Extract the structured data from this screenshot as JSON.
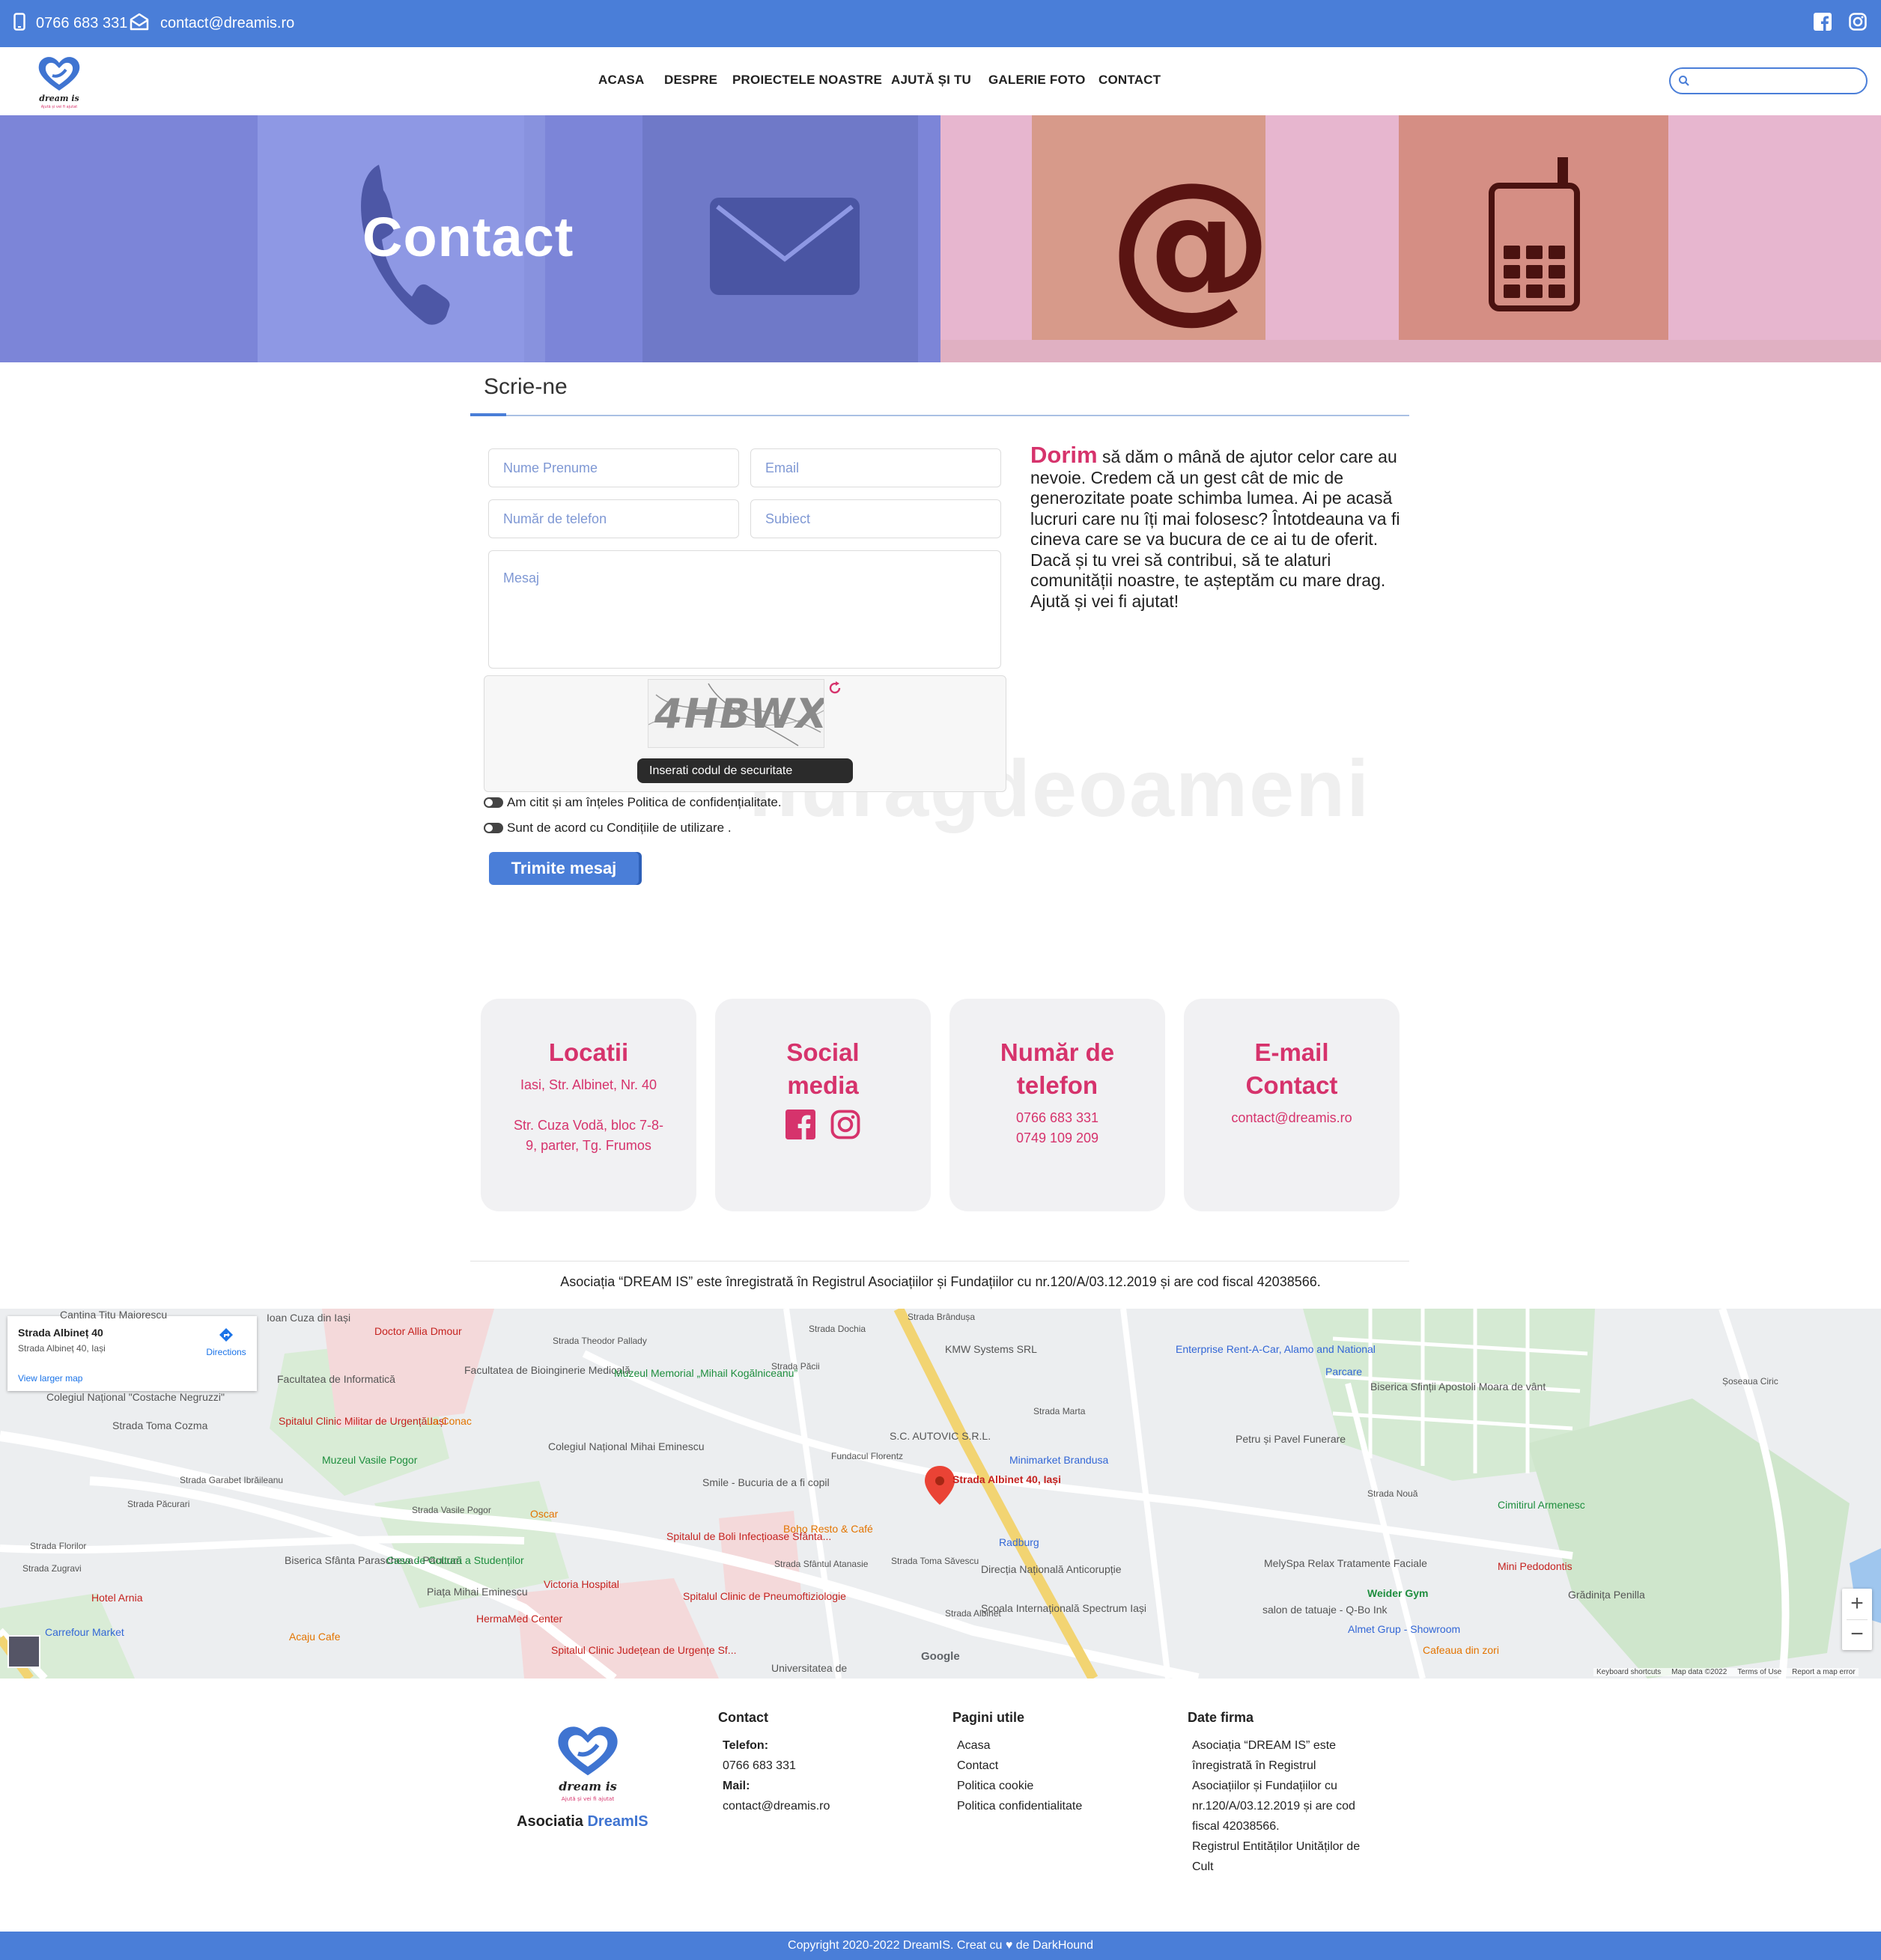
{
  "topbar": {
    "phone": "0766 683 331",
    "email": "contact@dreamis.ro",
    "social": [
      "facebook-icon",
      "instagram-icon"
    ]
  },
  "header": {
    "logo_text": "dream is",
    "logo_tagline": "Ajută și vei fi ajutat",
    "nav": [
      "ACASA",
      "DESPRE",
      "PROIECTELE NOASTRE",
      "AJUTĂ ȘI TU",
      "GALERIE FOTO",
      "CONTACT"
    ],
    "search_placeholder": ""
  },
  "hero": {
    "title": "Contact"
  },
  "form": {
    "heading": "Scrie-ne",
    "name_placeholder": "Nume Prenume",
    "email_placeholder": "Email",
    "phone_placeholder": "Număr de telefon",
    "subject_placeholder": "Subiect",
    "message_placeholder": "Mesaj",
    "captcha_code": "4HBWX",
    "captcha_tip": "Inserati codul de securitate",
    "privacy_label": "Am citit și am înțeles Politica de confidențialitate.",
    "terms_label": "Sunt de acord cu Condițiile de utilizare .",
    "submit_label": "Trimite mesaj"
  },
  "description": {
    "highlight": "Dorim",
    "text": " să dăm o mână de ajutor celor care au nevoie. Credem că un gest cât de mic de generozitate poate schimba lumea. Ai pe acasă lucruri care nu îți mai folosesc? Întotdeauna va fi cineva care se va bucura de ce ai tu de oferit. Dacă și tu vrei să contribui, să te alaturi comunității noastre, te așteptăm cu mare drag. Ajută și vei fi ajutat!",
    "watermark": "nuragdeoameni"
  },
  "cards": {
    "locations": {
      "title": "Locatii",
      "line1": "Iasi, Str. Albinet, Nr. 40",
      "line2": "Str. Cuza Vodă, bloc 7-8-9, parter, Tg. Frumos"
    },
    "social": {
      "title": "Social media"
    },
    "phone": {
      "title": "Număr de telefon",
      "line1": "0766 683 331",
      "line2": "0749 109 209"
    },
    "email": {
      "title": "E-mail Contact",
      "line1": "contact@dreamis.ro"
    }
  },
  "registration": "Asociația “DREAM IS” este înregistrată în Registrul Asociațiilor și Fundațiilor cu nr.120/A/03.12.2019 și are cod fiscal 42038566.",
  "map": {
    "place_title": "Strada Albineț 40",
    "place_address": "Strada Albineț 40, Iași",
    "directions": "Directions",
    "view_larger": "View larger map",
    "marker_label": "Strada Albinet 40, Iași",
    "labels": [
      "Cantina Titu Maiorescu",
      "Ioan Cuza din Iași",
      "Doctor Allia Dmour",
      "Facultatea de Informatică",
      "Facultatea de Bioinginerie Medicală",
      "Muzeul Memorial „Mihail Kogălniceanu”",
      "KMW Systems SRL",
      "Enterprise Rent-A-Car, Alamo and National",
      "Parcare",
      "Biserica Sfinții Apostoli Moara de vânt",
      "Colegiul Național \"Costache Negruzzi\"",
      "Strada Toma Cozma",
      "Spitalul Clinic Militar de Urgență Iași",
      "La Conac",
      "Colegiul Național Mihai Eminescu",
      "S.C. AUTOVIC S.R.L.",
      "Minimarket Brandusa",
      "Petru și Pavel Funerare",
      "Muzeul Vasile Pogor",
      "Smile - Bucuria de a fi copil",
      "Strada Albinet 40, Iași",
      "Cimitirul Armenesc",
      "Oscar",
      "Boho Resto & Café",
      "Radburg",
      "Spitalul de Boli Infecțioase Sfânta...",
      "Biserica Sfânta Parascheva - Păcurari",
      "Casa de Cultură a Studenților",
      "Direcția Națională Anticorupție",
      "MelySpa Relax Tratamente Faciale",
      "Mini Pedodontis",
      "Hotel Arnia",
      "Victoria Hospital",
      "Piața Mihai Eminescu",
      "Spitalul Clinic de Pneumoftiziologie",
      "Weider Gym",
      "Grădinița Penilla",
      "Carrefour Market",
      "Acaju Cafe",
      "HermaMed Center",
      "Școala Internațională Spectrum Iași",
      "salon de tatuaje - Q-Bo Ink",
      "Almet Grup - Showroom",
      "Cafeaua din zori",
      "Spitalul Clinic Județean de Urgențe Sf...",
      "Universitatea de",
      "Strada Garabet Ibrăileanu",
      "Strada Păcurari",
      "Strada Vasile Pogor",
      "Strada Zugravi",
      "Strada Florilor",
      "Strada Theodor Pallady",
      "Strada Brândușa",
      "Strada Păcii",
      "Strada Dochia",
      "Fundacul Florentz",
      "Strada Marta",
      "Strada Nouă",
      "Strada Sfântul Atanasie",
      "Strada Toma Săvescu",
      "Strada Albinet",
      "Șoseaua Ciric"
    ],
    "attribution": [
      "Keyboard shortcuts",
      "Map data ©2022",
      "Terms of Use",
      "Report a map error"
    ],
    "google": "Google"
  },
  "footer": {
    "org_prefix": "Asociatia ",
    "org_name": "DreamIS",
    "contact_title": "Contact",
    "phone_label": "Telefon:",
    "phone_value": "0766 683 331",
    "mail_label": "Mail:",
    "mail_value": "contact@dreamis.ro",
    "pages_title": "Pagini utile",
    "pages": [
      "Acasa",
      "Contact",
      "Politica cookie",
      "Politica confidentialitate"
    ],
    "company_title": "Date firma",
    "company_lines": [
      "Asociația “DREAM IS” este",
      "înregistrată în Registrul",
      "Asociațiilor și Fundațiilor cu",
      "nr.120/A/03.12.2019 și are cod",
      "fiscal 42038566.",
      "Registrul Entităților Unităților de",
      "Cult"
    ],
    "copyright": "Copyright 2020-2022 DreamIS. Creat cu ♥ de DarkHound"
  },
  "colors": {
    "primary": "#4a7ed8",
    "accent": "#d6336c",
    "hero_left": "#7c85d8",
    "hero_right": "#e7b6cf"
  }
}
